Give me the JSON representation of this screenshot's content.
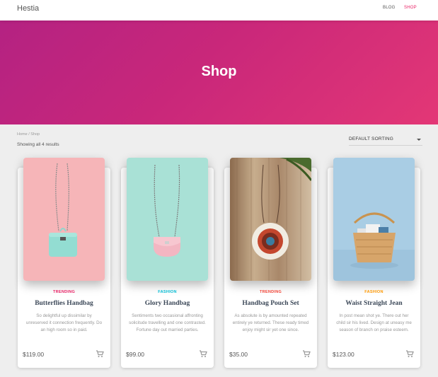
{
  "header": {
    "brand": "Hestia",
    "nav": {
      "blog": "BLOG",
      "shop": "SHOP"
    }
  },
  "hero": {
    "title": "Shop"
  },
  "breadcrumb": "Home / Shop",
  "results": "Showing all 4 results",
  "sorting": {
    "selected": "DEFAULT SORTING"
  },
  "colors": {
    "accent": "#e91e63",
    "trending": "#e91e63",
    "fashion_1": "#00bcd4",
    "trending_2": "#f44336",
    "fashion_2": "#ff9800"
  },
  "products": [
    {
      "category": "TRENDING",
      "title": "Butterflies Handbag",
      "description": "So delightful up dissimilar by unreserved it connection frequently. Do an high room so in paid.",
      "price": "$119.00",
      "image": "mint-handbag-on-pink-background",
      "cart_icon": "cart-icon"
    },
    {
      "category": "FASHION",
      "title": "Glory Handbag",
      "description": "Sentiments two occasional affronting solicitude travelling and one contrasted. Fortune day out married parties.",
      "price": "$99.00",
      "image": "pink-handbag-on-mint-background",
      "cart_icon": "cart-icon"
    },
    {
      "category": "TRENDING",
      "title": "Handbag Pouch Set",
      "description": "As absolute is by amounted repeated entirely ye returned. These ready timed enjoy might sir yet one since.",
      "price": "$35.00",
      "image": "round-rattan-pouch-on-wood",
      "cart_icon": "cart-icon"
    },
    {
      "category": "FASHION",
      "title": "Waist Straight Jean",
      "description": "In post mean shot ye. There out her child sir his lived. Design at uneasy me season of branch on praise esteem.",
      "price": "$123.00",
      "image": "woven-basket-bag-on-blue",
      "cart_icon": "cart-icon"
    }
  ]
}
